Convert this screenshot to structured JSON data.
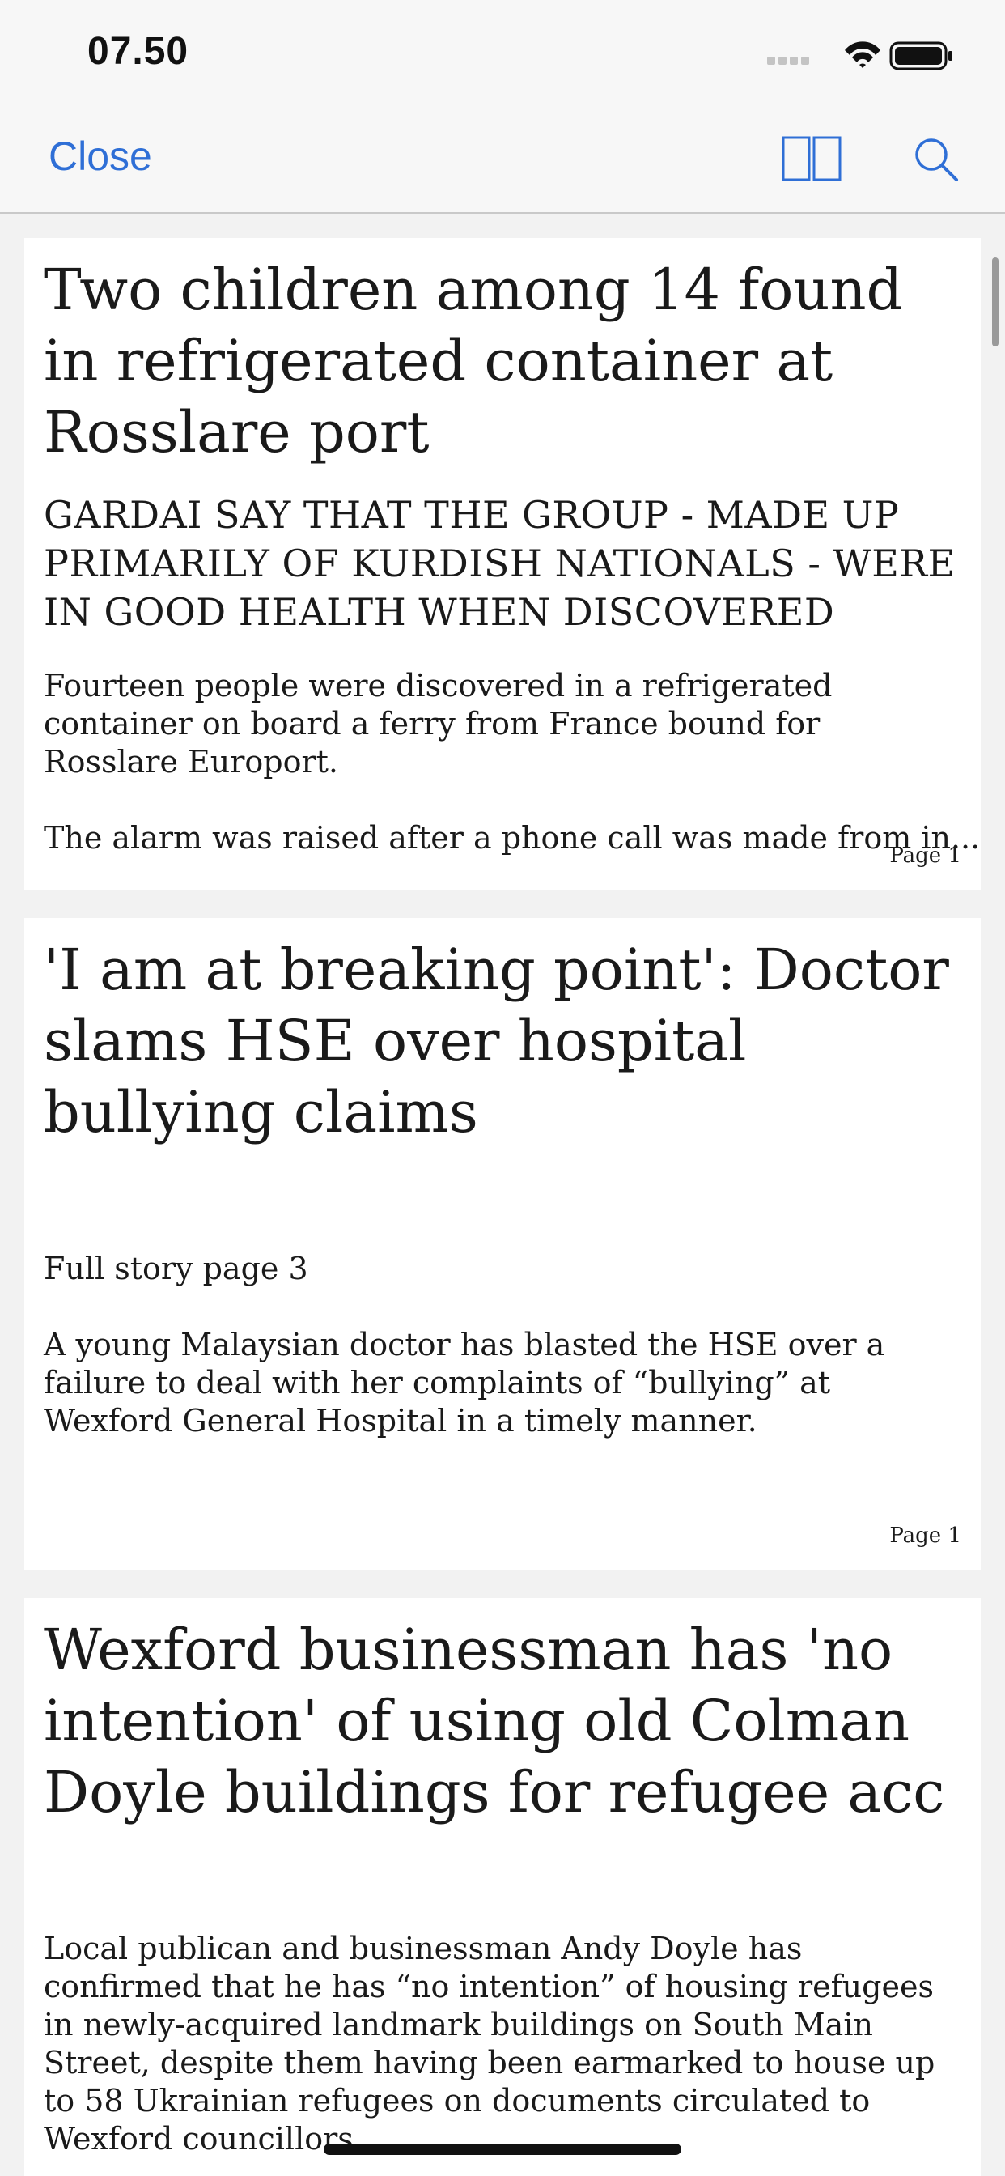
{
  "status_bar": {
    "time": "07.50"
  },
  "nav": {
    "close_label": "Close"
  },
  "articles": [
    {
      "title": "Two children among 14 found in refrigerated container at Rosslare port",
      "subtitle": "GARDAI SAY THAT THE GROUP - MADE UP PRIMARILY OF KURDISH NATIONALS - WERE IN GOOD HEALTH WHEN DISCOVERED",
      "paragraphs": [
        "Fourteen people were discovered in a refrigerated container on board a ferry from France bound for Rosslare Europort.",
        "The alarm was raised after a phone call was made from in..."
      ],
      "page": "Page 1"
    },
    {
      "title": "'I am at breaking point': Doctor slams HSE over hospital bullying claims",
      "paragraphs": [
        "Full story page 3",
        "A young Malaysian doctor has blasted the HSE over a failure to deal with her complaints of “bullying” at Wexford General Hospital in a timely manner."
      ],
      "page": "Page 1"
    },
    {
      "title": "Wexford businessman has 'no intention' of using old Colman Doyle buildings for refugee acc",
      "paragraphs": [
        "Local publican and businessman Andy Doyle has confirmed that he has “no intention” of housing refugees in newly-acquired landmark buildings on South Main Street, despite them having been earmarked to house up to 58 Ukrainian refugees on documents circulated to Wexford councillors."
      ]
    }
  ],
  "icons": {
    "signal": "cellular-signal-icon",
    "wifi": "wifi-icon",
    "battery": "battery-icon",
    "layout": "two-page-layout-icon",
    "search": "search-icon"
  },
  "colors": {
    "accent": "#2f6fd6",
    "background": "#f2f2f2",
    "card": "#ffffff",
    "bar": "#f7f7f7"
  }
}
